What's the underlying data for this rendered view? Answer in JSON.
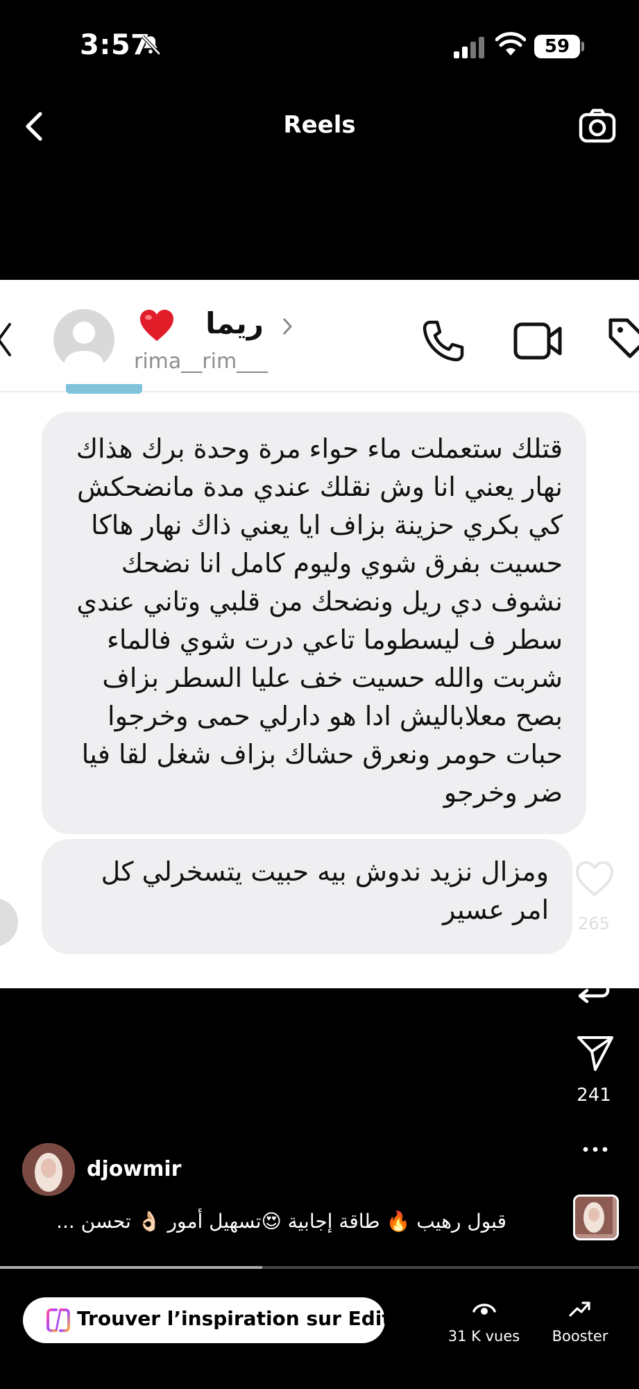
{
  "status_bar": {
    "time": "3:57",
    "battery": "59"
  },
  "header": {
    "title": "Reels"
  },
  "chat": {
    "contact_name": "ريما",
    "contact_handle": "rima__rim___",
    "messages": [
      "قتلك ستعملت ماء حواء مرة وحدة برك هذاك نهار يعني انا وش نقلك عندي مدة مانضحكش كي بكري حزينة بزاف ايا يعني ذاك نهار هاكا حسيت بفرق شوي وليوم كامل انا نضحك نشوف دي ريل ونضحك من قلبي وتاني عندي سطر ف ليسطوما تاعي درت شوي فالماء شربت والله حسيت خف عليا السطر بزاف بصح معلاباليش ادا هو دارلي حمى وخرجوا حبات حومر ونعرق حشاك بزاف شغل لقا فيا ضر وخرجو",
      "ومزال نزيد ندوش بيه حبيت يتسخرلي كل امر عسير"
    ]
  },
  "actions": {
    "like_count": "265",
    "share_count": "241"
  },
  "post": {
    "username": "djowmir",
    "caption": "قبول رهيب 🔥 طاقة إجابية 😍تسهيل أمور 👌🏻 تحسن ...",
    "progress": 0.41
  },
  "bottom_bar": {
    "edits_label": "Trouver l’inspiration sur Edits",
    "views_label": "31 K vues",
    "boost_label": "Booster"
  }
}
